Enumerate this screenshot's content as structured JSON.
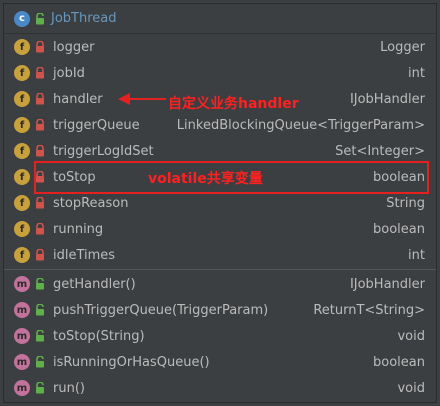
{
  "header": {
    "title": "JobThread",
    "badge": "c"
  },
  "fields": [
    {
      "name": "logger",
      "type": "Logger",
      "badge": "f"
    },
    {
      "name": "jobId",
      "type": "int",
      "badge": "f"
    },
    {
      "name": "handler",
      "type": "IJobHandler",
      "badge": "f"
    },
    {
      "name": "triggerQueue",
      "type": "LinkedBlockingQueue<TriggerParam>",
      "badge": "f"
    },
    {
      "name": "triggerLogIdSet",
      "type": "Set<Integer>",
      "badge": "f"
    },
    {
      "name": "toStop",
      "type": "boolean",
      "badge": "f"
    },
    {
      "name": "stopReason",
      "type": "String",
      "badge": "f"
    },
    {
      "name": "running",
      "type": "boolean",
      "badge": "f"
    },
    {
      "name": "idleTimes",
      "type": "int",
      "badge": "f"
    }
  ],
  "methods": [
    {
      "name": "getHandler()",
      "type": "IJobHandler",
      "badge": "m"
    },
    {
      "name": "pushTriggerQueue(TriggerParam)",
      "type": "ReturnT<String>",
      "badge": "m"
    },
    {
      "name": "toStop(String)",
      "type": "void",
      "badge": "m"
    },
    {
      "name": "isRunningOrHasQueue()",
      "type": "boolean",
      "badge": "m"
    },
    {
      "name": "run()",
      "type": "void",
      "badge": "m"
    }
  ],
  "annotations": {
    "handler_note": "自定义业务handler",
    "volatile_note": "volatile共享变量"
  },
  "colors": {
    "background": "#3c3f41",
    "text": "#bbbbbb",
    "title": "#6897bb",
    "field_badge": "#c7a13c",
    "method_badge": "#c2739b",
    "class_badge": "#4a89c7",
    "lock_private": "#d0534c",
    "lock_public": "#5fb04a",
    "annotation": "#e52020"
  },
  "icons": {
    "private": "lock-closed-icon",
    "public": "lock-open-icon"
  }
}
